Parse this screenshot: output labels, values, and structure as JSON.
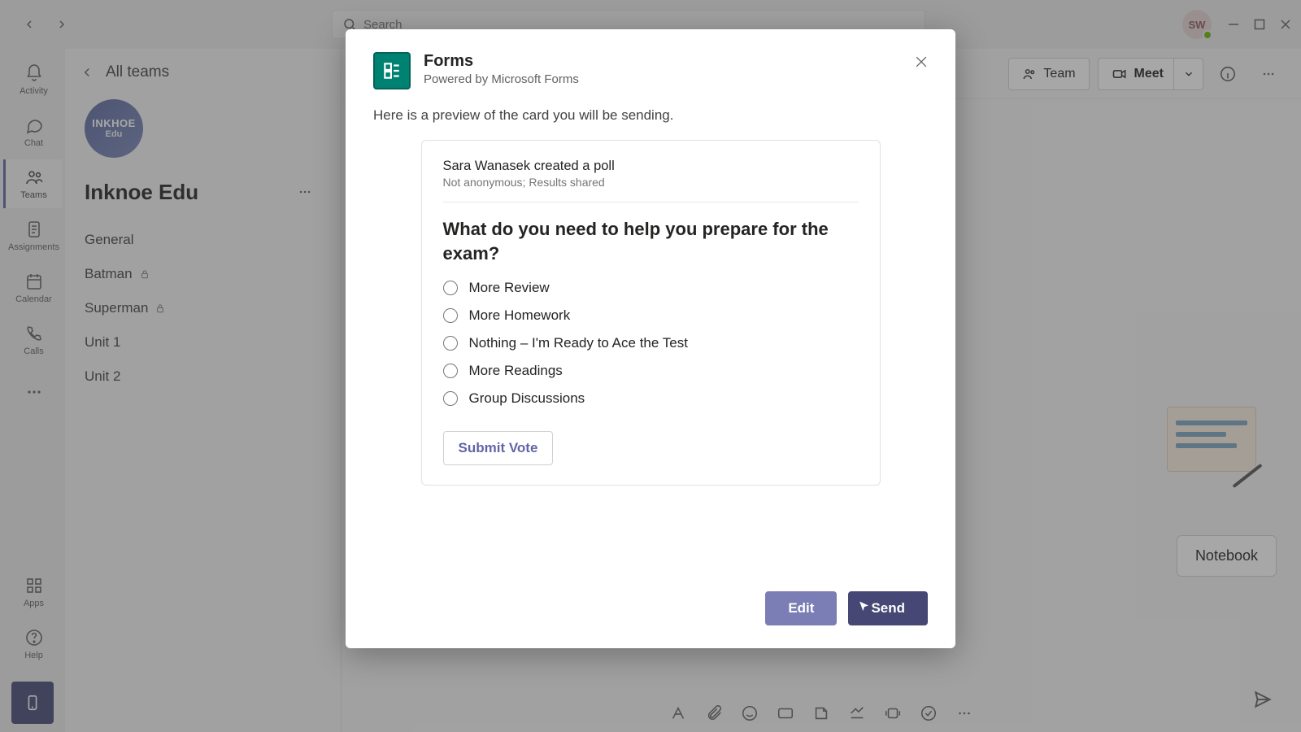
{
  "titlebar": {
    "search_placeholder": "Search",
    "avatar_initials": "SW"
  },
  "rail": {
    "activity": "Activity",
    "chat": "Chat",
    "teams": "Teams",
    "assignments": "Assignments",
    "calendar": "Calendar",
    "calls": "Calls",
    "apps": "Apps",
    "help": "Help"
  },
  "sidebar": {
    "back_label": "All teams",
    "team_avatar_l1": "INKHOE",
    "team_avatar_l2": "Edu",
    "team_name": "Inknoe Edu",
    "channels": [
      {
        "label": "General",
        "private": false
      },
      {
        "label": "Batman",
        "private": true
      },
      {
        "label": "Superman",
        "private": true
      },
      {
        "label": "Unit 1",
        "private": false
      },
      {
        "label": "Unit 2",
        "private": false
      }
    ]
  },
  "main": {
    "team_label": "Team",
    "meet_label": "Meet",
    "notebook_label": "Notebook"
  },
  "dialog": {
    "title": "Forms",
    "subtitle": "Powered by Microsoft Forms",
    "description": "Here is a preview of the card you will be sending.",
    "poll": {
      "creator_line": "Sara Wanasek created a poll",
      "settings_line": "Not anonymous; Results shared",
      "question": "What do you need to help you prepare for the exam?",
      "options": [
        "More Review",
        "More Homework",
        "Nothing – I'm Ready to Ace the Test",
        "More Readings",
        "Group Discussions"
      ],
      "submit_label": "Submit Vote"
    },
    "edit_label": "Edit",
    "send_label": "Send"
  }
}
